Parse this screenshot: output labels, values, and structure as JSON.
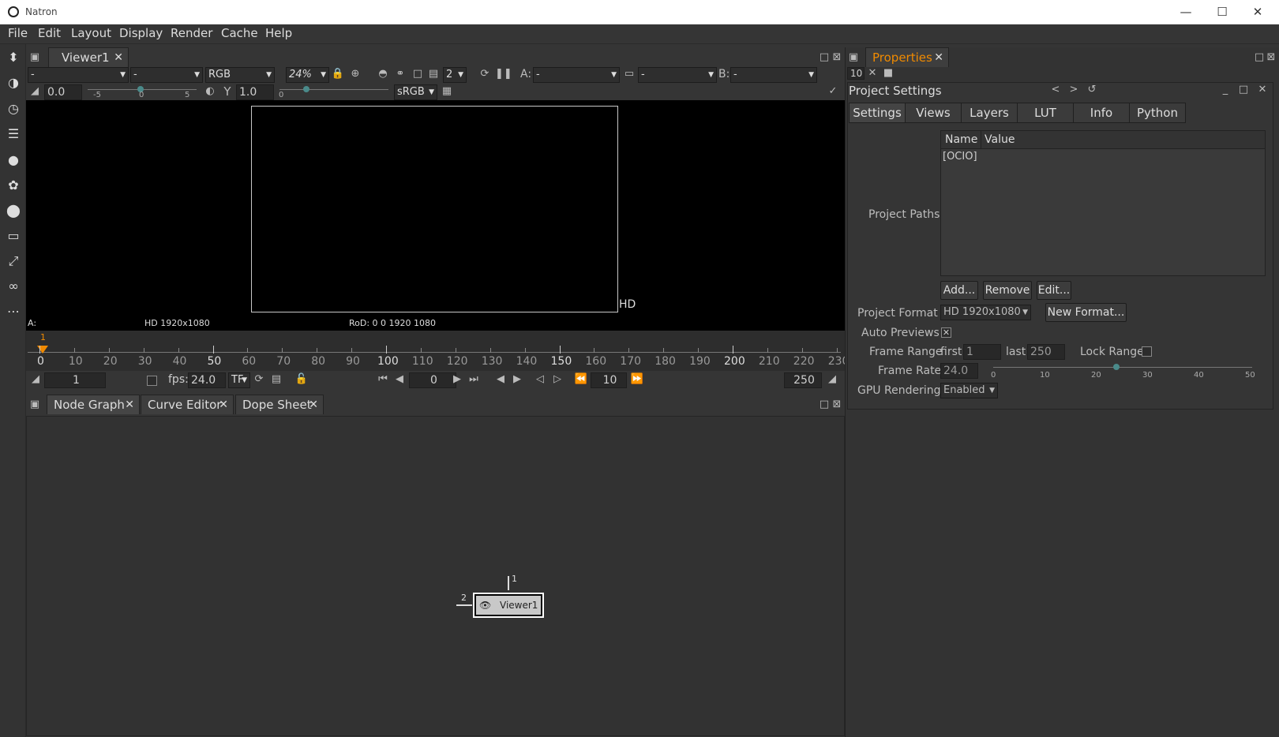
{
  "window": {
    "title": "Natron"
  },
  "menu": [
    "File",
    "Edit",
    "Layout",
    "Display",
    "Render",
    "Cache",
    "Help"
  ],
  "viewer": {
    "tab_label": "Viewer1",
    "layer_value": "-",
    "alpha_value": "-",
    "channels": "RGB",
    "zoom": "24%",
    "proxy_level": "2",
    "input_a_label": "A:",
    "input_a_value": "-",
    "composite_value": "-",
    "input_b_label": "B:",
    "input_b_value": "-",
    "gain_value": "0.0",
    "gain_ticks": [
      "-5",
      "0",
      "5"
    ],
    "gamma_label": "Y",
    "gamma_value": "1.0",
    "gamma_tick": "0",
    "colorspace": "sRGB",
    "format_label": "HD",
    "info_input": "A:",
    "info_format": "HD 1920x1080",
    "info_rod": "RoD: 0 0 1920 1080"
  },
  "timeline": {
    "current_marker": "1",
    "ticks": [
      "0",
      "10",
      "20",
      "30",
      "40",
      "50",
      "60",
      "70",
      "80",
      "90",
      "100",
      "110",
      "120",
      "130",
      "140",
      "150",
      "160",
      "170",
      "180",
      "190",
      "200",
      "210",
      "220",
      "230"
    ],
    "start_frame": "1",
    "fps_label": "fps:",
    "fps_value": "24.0",
    "tf_label": "TF",
    "current_frame": "0",
    "increment": "10",
    "end_frame": "250"
  },
  "bottom_tabs": [
    "Node Graph",
    "Curve Editor",
    "Dope Sheet"
  ],
  "node": {
    "label": "Viewer1",
    "input1": "1",
    "input2": "2"
  },
  "properties": {
    "tab_label": "Properties",
    "max_panels": "10",
    "panel_title": "Project Settings",
    "tabs": [
      "Settings",
      "Views",
      "Layers",
      "LUT",
      "Info",
      "Python"
    ],
    "project_paths_label": "Project Paths",
    "table_headers": [
      "Name",
      "Value"
    ],
    "table_rows": [
      "[OCIO]"
    ],
    "add_button": "Add...",
    "remove_button": "Remove",
    "edit_button": "Edit...",
    "format_label": "Project Format",
    "format_value": "HD 1920x1080",
    "new_format_button": "New Format...",
    "auto_previews_label": "Auto Previews",
    "frame_range_label": "Frame Range",
    "first_label": "first",
    "first_value": "1",
    "last_label": "last",
    "last_value": "250",
    "lock_range_label": "Lock Range",
    "frame_rate_label": "Frame Rate",
    "frame_rate_value": "24.0",
    "frame_rate_ticks": [
      "0",
      "10",
      "20",
      "30",
      "40",
      "50"
    ],
    "gpu_label": "GPU Rendering",
    "gpu_value": "Enabled"
  }
}
